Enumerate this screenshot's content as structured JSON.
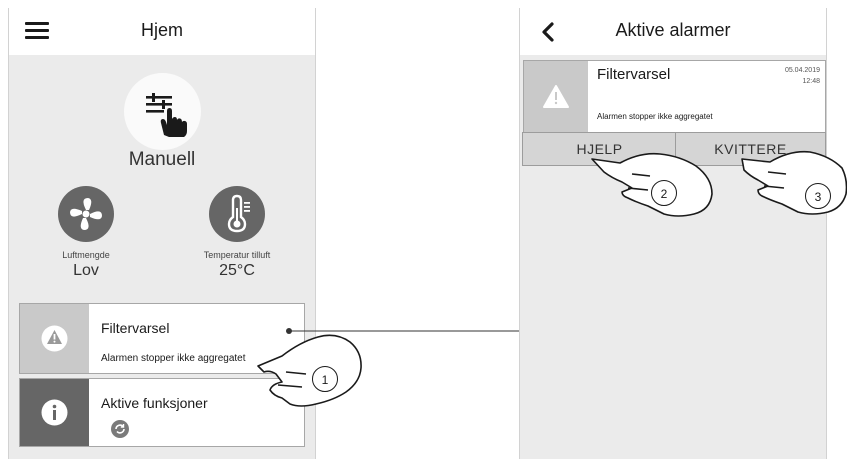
{
  "left_screen": {
    "title": "Hjem",
    "mode": "Manuell",
    "airflow": {
      "label": "Luftmengde",
      "value": "Lov"
    },
    "supply_temp": {
      "label": "Temperatur tilluft",
      "value": "25°C"
    },
    "alarm_card": {
      "title": "Filtervarsel",
      "subtitle": "Alarmen stopper ikke aggregatet"
    },
    "functions_card": {
      "title": "Aktive funksjoner"
    }
  },
  "right_screen": {
    "title": "Aktive alarmer",
    "alarm": {
      "title": "Filtervarsel",
      "subtitle": "Alarmen stopper ikke aggregatet",
      "date": "05.04.2019",
      "time": "12:48"
    },
    "help_button": "HJELP",
    "ack_button": "KVITTERE"
  },
  "callouts": [
    "1",
    "2",
    "3"
  ],
  "colors": {
    "screen_bg": "#ebebeb",
    "icon_dark": "#666666",
    "alarm_side": "#c9c9c9",
    "functions_side": "#666666"
  }
}
